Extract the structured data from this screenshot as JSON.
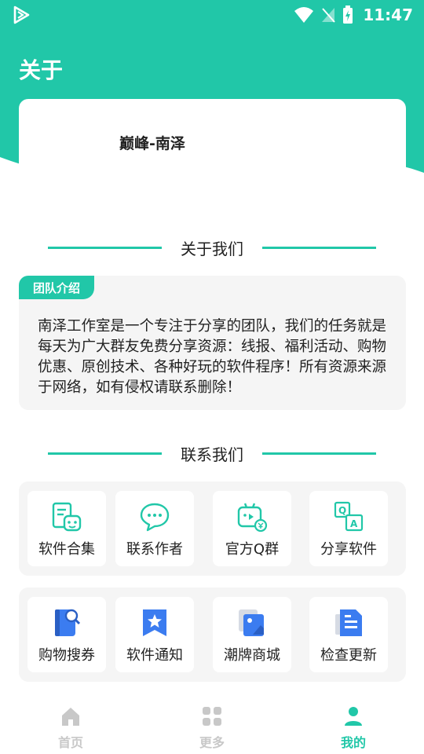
{
  "status_bar": {
    "time": "11:47"
  },
  "header": {
    "title": "关于"
  },
  "profile": {
    "name": "巅峰-南泽"
  },
  "about": {
    "section_title": "关于我们",
    "badge": "团队介绍",
    "text": "南泽工作室是一个专注于分享的团队，我们的任务就是每天为广大群友免费分享资源：线报、福利活动、购物优惠、原创技术、各种好玩的软件程序！所有资源来源于网络，如有侵权请联系删除！"
  },
  "contact": {
    "section_title": "联系我们",
    "row1": [
      {
        "label": "软件合集",
        "icon": "software-collection-icon"
      },
      {
        "label": "联系作者",
        "icon": "chat-bubble-icon"
      },
      {
        "label": "官方Q群",
        "icon": "qq-group-icon"
      },
      {
        "label": "分享软件",
        "icon": "qa-share-icon"
      }
    ],
    "row2": [
      {
        "label": "购物搜券",
        "icon": "coupon-search-icon"
      },
      {
        "label": "软件通知",
        "icon": "bookmark-star-icon"
      },
      {
        "label": "潮牌商城",
        "icon": "mall-image-icon"
      },
      {
        "label": "检查更新",
        "icon": "document-update-icon"
      }
    ]
  },
  "bottom_nav": {
    "items": [
      {
        "label": "首页",
        "icon": "home-icon",
        "active": false
      },
      {
        "label": "更多",
        "icon": "grid-more-icon",
        "active": false
      },
      {
        "label": "我的",
        "icon": "person-icon",
        "active": true
      }
    ]
  },
  "colors": {
    "accent": "#21c7a8",
    "card_bg": "#f5f5f5",
    "icon_blue": "#3b7cf0",
    "inactive": "#c8c8c8"
  }
}
